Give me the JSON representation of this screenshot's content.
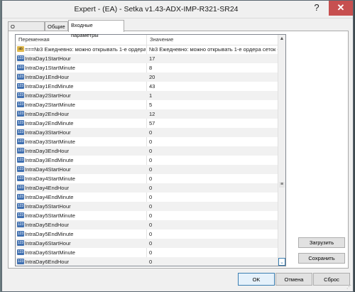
{
  "window": {
    "title": "Expert - (EA) - Setka v1.43-ADX-IMP-R321-SR24",
    "help_glyph": "?",
    "close_glyph": "✕"
  },
  "tabs": [
    {
      "label": "О программе"
    },
    {
      "label": "Общие"
    },
    {
      "label": "Входные параметры"
    }
  ],
  "grid": {
    "headers": {
      "name": "Переменная",
      "value": "Значение"
    },
    "rows": [
      {
        "icon": "ab",
        "name": "===№3 Ежедневно: можно открывать 1-е ордера - ...",
        "value": "№3 Ежедневно: можно открывать 1-е ордера сеток - ..."
      },
      {
        "icon": "123",
        "name": "IntraDay1StartHour",
        "value": "17"
      },
      {
        "icon": "123",
        "name": "IntraDay1StartMinute",
        "value": "8"
      },
      {
        "icon": "123",
        "name": "IntraDay1EndHour",
        "value": "20"
      },
      {
        "icon": "123",
        "name": "IntraDay1EndMinute",
        "value": "43"
      },
      {
        "icon": "123",
        "name": "IntraDay2StartHour",
        "value": "1"
      },
      {
        "icon": "123",
        "name": "IntraDay2StartMinute",
        "value": "5"
      },
      {
        "icon": "123",
        "name": "IntraDay2EndHour",
        "value": "12"
      },
      {
        "icon": "123",
        "name": "IntraDay2EndMinute",
        "value": "57"
      },
      {
        "icon": "123",
        "name": "IntraDay3StartHour",
        "value": "0"
      },
      {
        "icon": "123",
        "name": "IntraDay3StartMinute",
        "value": "0"
      },
      {
        "icon": "123",
        "name": "IntraDay3EndHour",
        "value": "0"
      },
      {
        "icon": "123",
        "name": "IntraDay3EndMinute",
        "value": "0"
      },
      {
        "icon": "123",
        "name": "IntraDay4StartHour",
        "value": "0"
      },
      {
        "icon": "123",
        "name": "IntraDay4StartMinute",
        "value": "0"
      },
      {
        "icon": "123",
        "name": "IntraDay4EndHour",
        "value": "0"
      },
      {
        "icon": "123",
        "name": "IntraDay4EndMinute",
        "value": "0"
      },
      {
        "icon": "123",
        "name": "IntraDay5StartHour",
        "value": "0"
      },
      {
        "icon": "123",
        "name": "IntraDay5StartMinute",
        "value": "0"
      },
      {
        "icon": "123",
        "name": "IntraDay5EndHour",
        "value": "0"
      },
      {
        "icon": "123",
        "name": "IntraDay5EndMinute",
        "value": "0"
      },
      {
        "icon": "123",
        "name": "IntraDay6StartHour",
        "value": "0"
      },
      {
        "icon": "123",
        "name": "IntraDay6StartMinute",
        "value": "0"
      },
      {
        "icon": "123",
        "name": "IntraDay6EndHour",
        "value": "0"
      }
    ]
  },
  "side_buttons": {
    "load": "Загрузить",
    "save": "Сохранить"
  },
  "buttons": {
    "ok": "OK",
    "cancel": "Отмена",
    "reset": "Сброс"
  },
  "icons": {
    "int": "integer-param-icon",
    "str": "string-param-icon",
    "scroll_up": "scroll-up-icon",
    "scroll_down": "scroll-down-icon",
    "scroll_thumb": "scroll-thumb-grip-icon"
  }
}
